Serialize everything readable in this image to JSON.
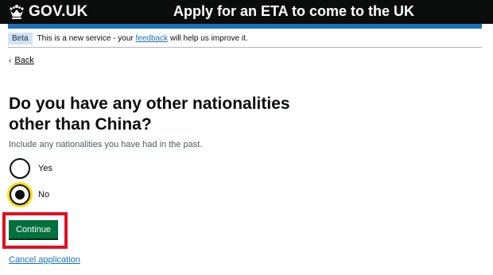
{
  "header": {
    "logo_text": "GOV.UK",
    "service_name": "Apply for an ETA to come to the UK"
  },
  "phase_banner": {
    "tag": "Beta",
    "text_before": "This is a new service - your ",
    "link_text": "feedback",
    "text_after": " will help us improve it."
  },
  "back_link": {
    "label": "Back"
  },
  "question": {
    "heading": "Do you have any other nationalities other than China?",
    "hint": "Include any nationalities you have had in the past.",
    "options": [
      {
        "label": "Yes",
        "selected": false
      },
      {
        "label": "No",
        "selected": true
      }
    ]
  },
  "actions": {
    "continue_label": "Continue",
    "cancel_label": "Cancel application"
  },
  "colors": {
    "header_bg": "#0b0c0c",
    "header_rule": "#1d70b8",
    "button_green": "#00703c",
    "focus_yellow": "#ffdd00",
    "link_blue": "#1d70b8",
    "highlight_red": "#e01020"
  }
}
